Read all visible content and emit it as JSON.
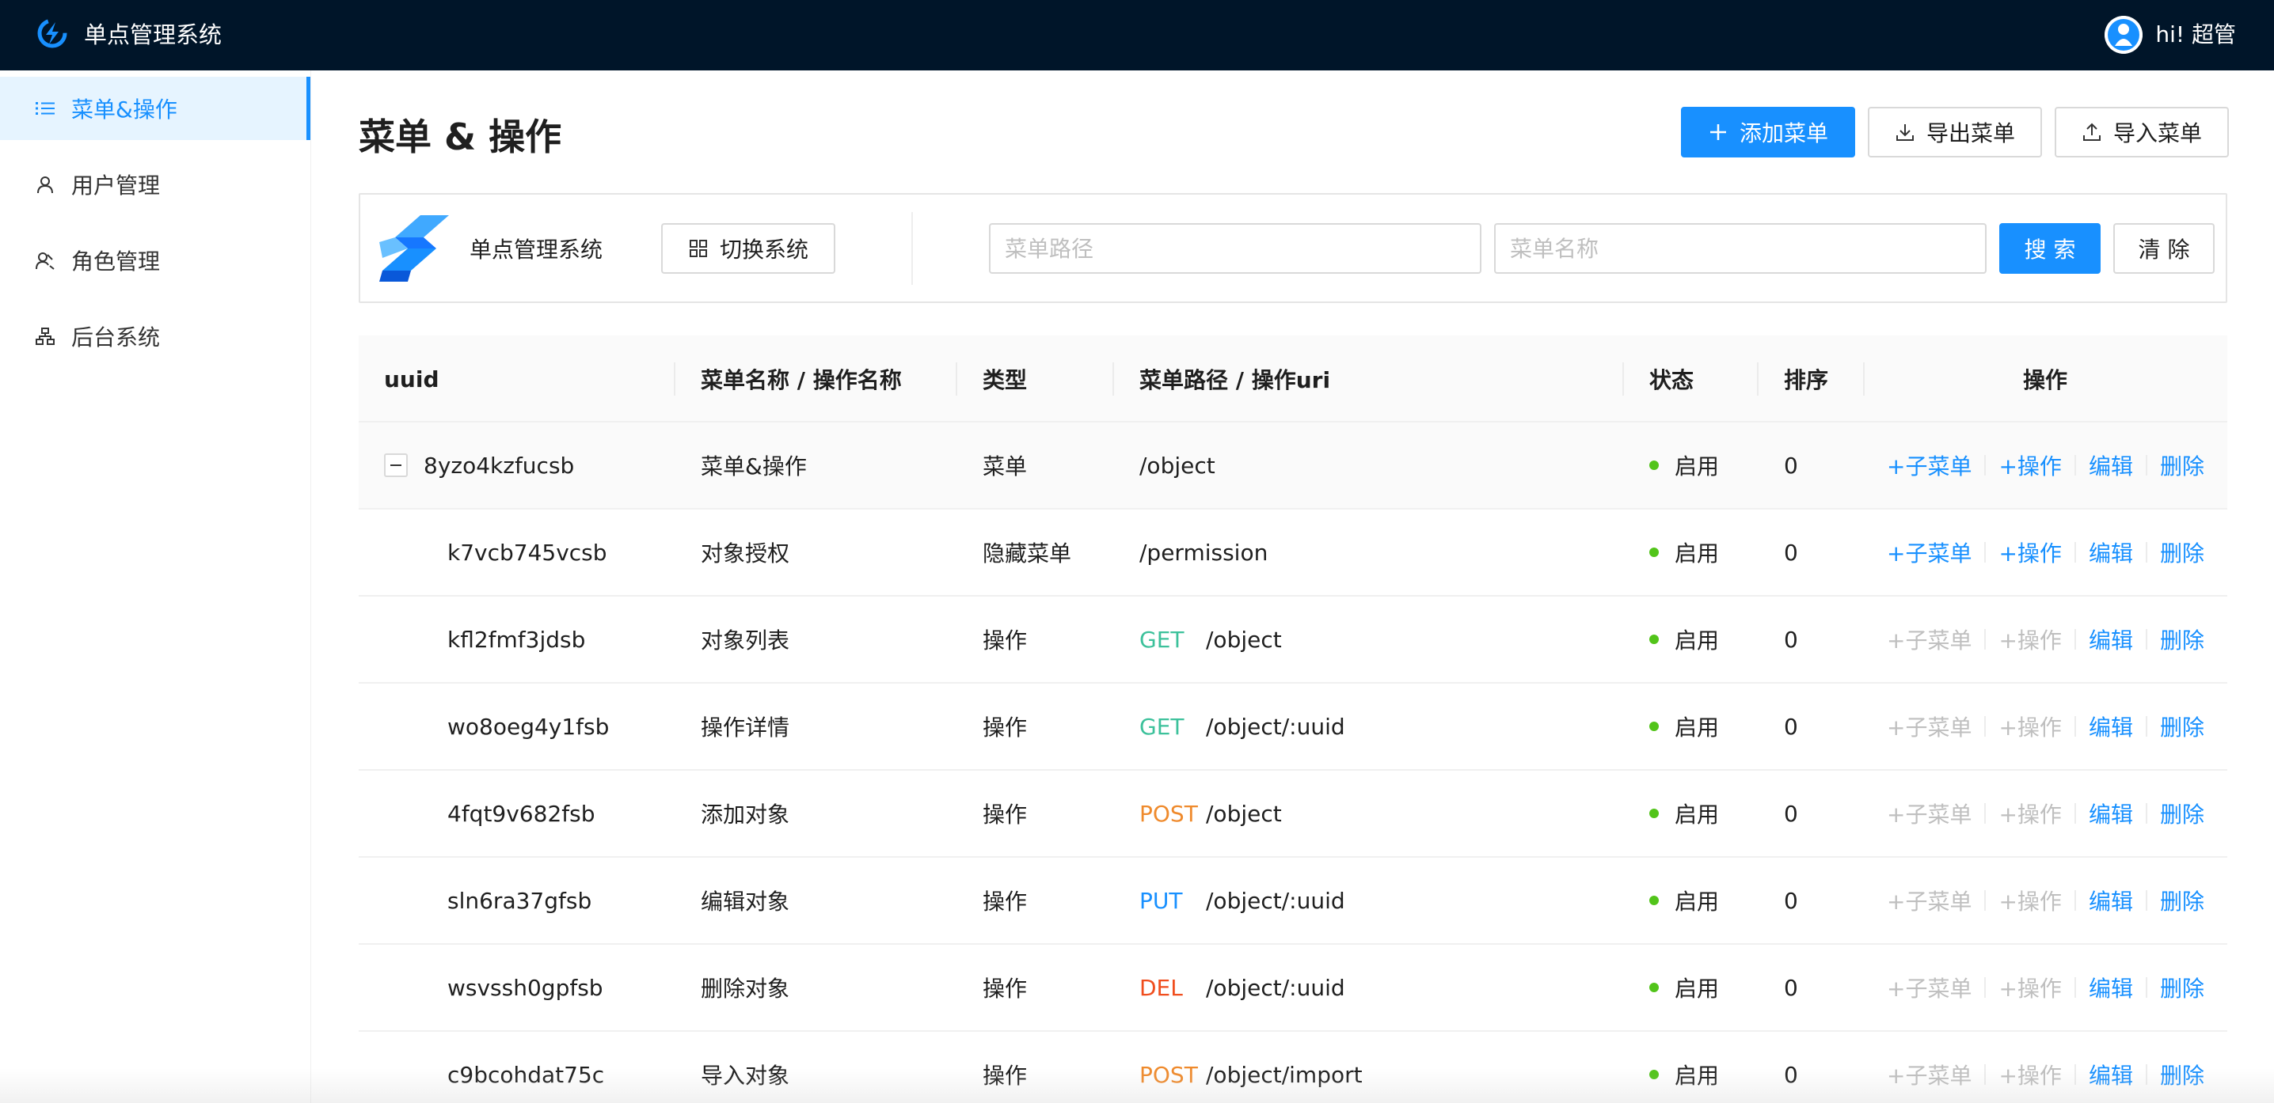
{
  "header": {
    "app_title": "单点管理系统",
    "user_greeting": "hi! 超管"
  },
  "sidebar": {
    "items": [
      {
        "label": "菜单&操作",
        "icon": "list-icon",
        "active": true
      },
      {
        "label": "用户管理",
        "icon": "user-icon",
        "active": false
      },
      {
        "label": "角色管理",
        "icon": "team-icon",
        "active": false
      },
      {
        "label": "后台系统",
        "icon": "cluster-icon",
        "active": false
      }
    ]
  },
  "page": {
    "title": "菜单 & 操作",
    "add_menu_label": "添加菜单",
    "export_menu_label": "导出菜单",
    "import_menu_label": "导入菜单"
  },
  "filter": {
    "system_name": "单点管理系统",
    "switch_system_label": "切换系统",
    "path_placeholder": "菜单路径",
    "name_placeholder": "菜单名称",
    "search_label": "搜 索",
    "clear_label": "清 除"
  },
  "table": {
    "columns": [
      "uuid",
      "菜单名称 / 操作名称",
      "类型",
      "菜单路径 / 操作uri",
      "状态",
      "排序",
      "操作"
    ],
    "action_labels": {
      "add_child": "+子菜单",
      "add_action": "+操作",
      "edit": "编辑",
      "delete": "删除"
    },
    "rows": [
      {
        "uuid": "8yzo4kzfucsb",
        "name": "菜单&操作",
        "type": "菜单",
        "method": "",
        "path": "/object",
        "status": "启用",
        "order": "0",
        "level": 0,
        "expandable": true,
        "children_enabled": true
      },
      {
        "uuid": "k7vcb745vcsb",
        "name": "对象授权",
        "type": "隐藏菜单",
        "method": "",
        "path": "/permission",
        "status": "启用",
        "order": "0",
        "level": 1,
        "expandable": false,
        "children_enabled": true
      },
      {
        "uuid": "kfl2fmf3jdsb",
        "name": "对象列表",
        "type": "操作",
        "method": "GET",
        "path": "/object",
        "status": "启用",
        "order": "0",
        "level": 1,
        "expandable": false,
        "children_enabled": false
      },
      {
        "uuid": "wo8oeg4y1fsb",
        "name": "操作详情",
        "type": "操作",
        "method": "GET",
        "path": "/object/:uuid",
        "status": "启用",
        "order": "0",
        "level": 1,
        "expandable": false,
        "children_enabled": false
      },
      {
        "uuid": "4fqt9v682fsb",
        "name": "添加对象",
        "type": "操作",
        "method": "POST",
        "path": "/object",
        "status": "启用",
        "order": "0",
        "level": 1,
        "expandable": false,
        "children_enabled": false
      },
      {
        "uuid": "sln6ra37gfsb",
        "name": "编辑对象",
        "type": "操作",
        "method": "PUT",
        "path": "/object/:uuid",
        "status": "启用",
        "order": "0",
        "level": 1,
        "expandable": false,
        "children_enabled": false
      },
      {
        "uuid": "wsvssh0gpfsb",
        "name": "删除对象",
        "type": "操作",
        "method": "DEL",
        "path": "/object/:uuid",
        "status": "启用",
        "order": "0",
        "level": 1,
        "expandable": false,
        "children_enabled": false
      },
      {
        "uuid": "c9bcohdat75c",
        "name": "导入对象",
        "type": "操作",
        "method": "POST",
        "path": "/object/import",
        "status": "启用",
        "order": "0",
        "level": 1,
        "expandable": false,
        "children_enabled": false
      }
    ]
  },
  "colors": {
    "header_bg": "#001529",
    "primary": "#1890ff",
    "GET": "#3cc19b",
    "POST": "#ef8a2c",
    "PUT": "#1890ff",
    "DEL": "#f04e1e",
    "status_enabled": "#52c41a"
  }
}
